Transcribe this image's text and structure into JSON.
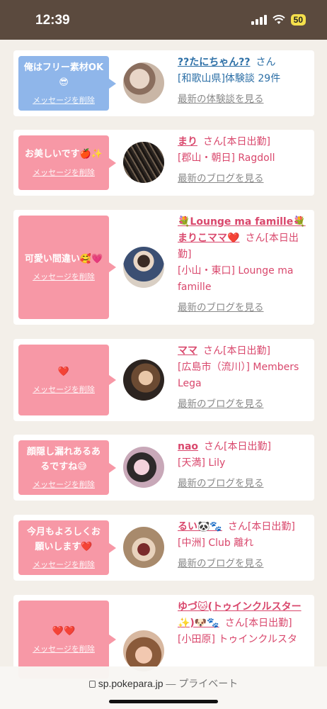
{
  "status": {
    "time": "12:39",
    "battery": "50"
  },
  "browser": {
    "url": "sp.pokepara.jp",
    "url_suffix": "— プライベート"
  },
  "delete_label": "メッセージを削除",
  "cards": [
    {
      "bubble_color": "blue",
      "message": "俺はフリー素材OK😎",
      "name": "??たにちゃん??",
      "honorific": "さん",
      "extra": "",
      "line2": "[和歌山県]体験談 29件",
      "link": "最新の体験談を見る"
    },
    {
      "bubble_color": "pink",
      "message": "お美しいです🍎✨",
      "name": "まり",
      "honorific": "さん",
      "extra": "[本日出勤]",
      "line2": "[郡山・朝日] Ragdoll",
      "link": "最新のブログを見る"
    },
    {
      "bubble_color": "pink",
      "message": "可愛い間違い🥰💗",
      "name": "💐Lounge ma famille💐まりこママ❤️",
      "honorific": "さん",
      "extra": "[本日出勤]",
      "line2": "[小山・東口] Lounge ma famille",
      "link": "最新のブログを見る"
    },
    {
      "bubble_color": "pink",
      "message": "❤️",
      "name": "ママ",
      "honorific": "さん",
      "extra": "[本日出勤]",
      "line2": "[広島市（流川）] Members Lega",
      "link": "最新のブログを見る"
    },
    {
      "bubble_color": "pink",
      "message": "顔隠し漏れあるあるですね😅",
      "name": "nao",
      "honorific": "さん",
      "extra": "[本日出勤]",
      "line2": "[天満] Lily",
      "link": "最新のブログを見る"
    },
    {
      "bubble_color": "pink",
      "message": "今月もよろしくお願いします❤️",
      "name": "るい🐼🐾",
      "honorific": "さん",
      "extra": "[本日出勤]",
      "line2": "[中洲] Club 離れ",
      "link": "最新のブログを見る"
    },
    {
      "bubble_color": "pink",
      "message": "❤️❤️",
      "name": "ゆづ🐱(トゥインクルスター✨)🐶🐾",
      "honorific": "さん",
      "extra": "[本日出勤]",
      "line2": "[小田原] トゥインクルスタ",
      "link": ""
    }
  ]
}
